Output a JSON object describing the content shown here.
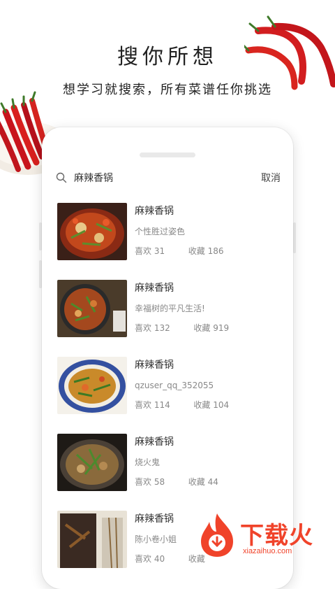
{
  "promo": {
    "title": "搜你所想",
    "subtitle": "想学习就搜索，所有菜谱任你挑选"
  },
  "search": {
    "icon": "search-icon",
    "query": "麻辣香锅",
    "cancel_label": "取消"
  },
  "results": [
    {
      "title": "麻辣香锅",
      "author": "个性胜过姿色",
      "likes_label": "喜欢",
      "likes": "31",
      "favs_label": "收藏",
      "favs": "186"
    },
    {
      "title": "麻辣香锅",
      "author": "幸福树的平凡生活!",
      "likes_label": "喜欢",
      "likes": "132",
      "favs_label": "收藏",
      "favs": "919"
    },
    {
      "title": "麻辣香锅",
      "author": "qzuser_qq_352055",
      "likes_label": "喜欢",
      "likes": "114",
      "favs_label": "收藏",
      "favs": "104"
    },
    {
      "title": "麻辣香锅",
      "author": "烧火鬼",
      "likes_label": "喜欢",
      "likes": "58",
      "favs_label": "收藏",
      "favs": "44"
    },
    {
      "title": "麻辣香锅",
      "author": "陈小卷小姐",
      "likes_label": "喜欢",
      "likes": "40",
      "favs_label": "收藏",
      "favs": ""
    }
  ],
  "watermark": {
    "name": "下载火",
    "url": "xiazaihuo.com"
  },
  "colors": {
    "brand_red": "#f0432a",
    "text_primary": "#333333",
    "text_secondary": "#888888"
  }
}
